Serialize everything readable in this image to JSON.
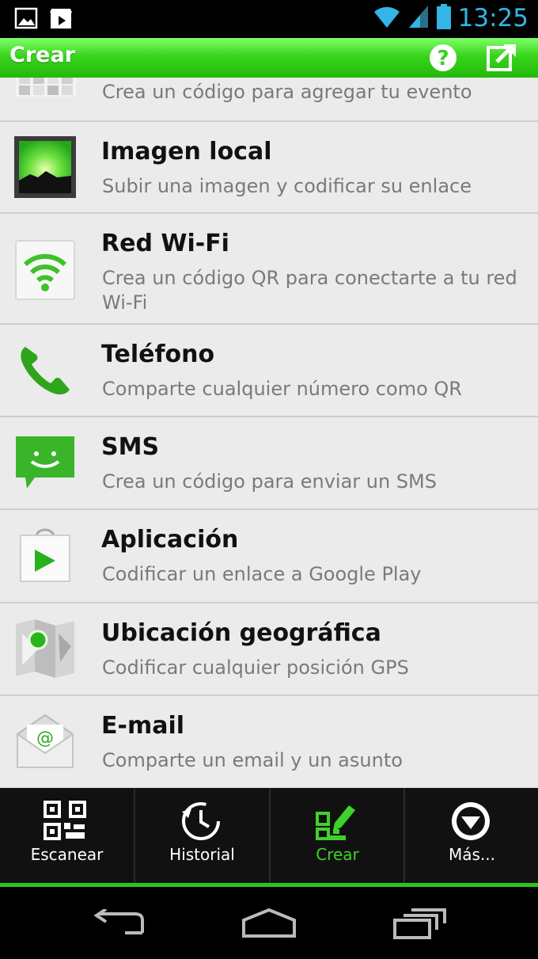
{
  "status_bar": {
    "time": "13:25"
  },
  "app_bar": {
    "title": "Crear"
  },
  "items": [
    {
      "subtitle": "Crea un código para agregar tu evento"
    },
    {
      "title": "Imagen local",
      "subtitle": "Subir una imagen y codificar su enlace",
      "icon": "image-icon"
    },
    {
      "title": "Red Wi-Fi",
      "subtitle": "Crea un código QR para conectarte a tu red Wi-Fi",
      "icon": "wifi-icon"
    },
    {
      "title": "Teléfono",
      "subtitle": "Comparte cualquier número como QR",
      "icon": "phone-icon"
    },
    {
      "title": "SMS",
      "subtitle": "Crea un código para enviar un SMS",
      "icon": "sms-icon"
    },
    {
      "title": "Aplicación",
      "subtitle": "Codificar un enlace a Google Play",
      "icon": "play-store-icon"
    },
    {
      "title": "Ubicación geográfica",
      "subtitle": "Codificar cualquier posición GPS",
      "icon": "map-icon"
    },
    {
      "title": "E-mail",
      "subtitle": "Comparte un email y un asunto",
      "icon": "email-icon"
    }
  ],
  "tabs": [
    {
      "label": "Escanear",
      "icon": "qr-scan-icon"
    },
    {
      "label": "Historial",
      "icon": "history-icon"
    },
    {
      "label": "Crear",
      "icon": "qr-create-icon",
      "active": true
    },
    {
      "label": "Más...",
      "icon": "more-icon"
    }
  ],
  "colors": {
    "accent": "#2cc41b",
    "status_time": "#33b5e5"
  }
}
